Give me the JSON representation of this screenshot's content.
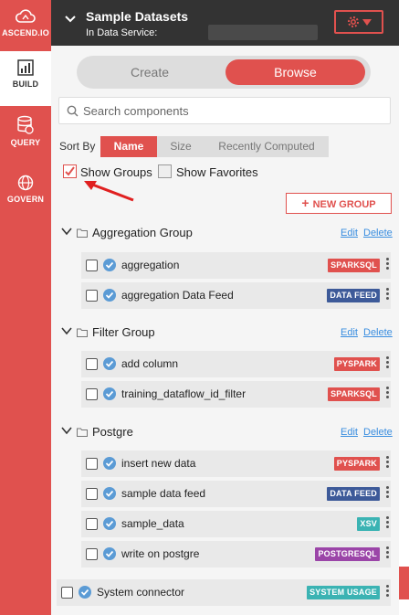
{
  "nav": {
    "logo_label": "ASCEND.IO",
    "items": [
      {
        "label": "BUILD"
      },
      {
        "label": "QUERY"
      },
      {
        "label": "GOVERN"
      }
    ]
  },
  "header": {
    "title": "Sample Datasets",
    "subtitle": "In Data Service:"
  },
  "mode_toggle": {
    "create_label": "Create",
    "browse_label": "Browse",
    "active": "Browse"
  },
  "search": {
    "placeholder": "Search components",
    "value": ""
  },
  "sort": {
    "label": "Sort By",
    "options": [
      "Name",
      "Size",
      "Recently Computed"
    ],
    "selected": "Name"
  },
  "filters": {
    "show_groups_label": "Show Groups",
    "show_groups_checked": true,
    "show_favorites_label": "Show Favorites",
    "show_favorites_checked": false
  },
  "new_group_label": "NEW GROUP",
  "group_actions": {
    "edit": "Edit",
    "delete": "Delete"
  },
  "groups": [
    {
      "name": "Aggregation Group",
      "items": [
        {
          "name": "aggregation",
          "type": "SPARKSQL"
        },
        {
          "name": "aggregation Data Feed",
          "type": "DATA FEED"
        }
      ]
    },
    {
      "name": "Filter Group",
      "items": [
        {
          "name": "add column",
          "type": "PYSPARK"
        },
        {
          "name": "training_dataflow_id_filter",
          "type": "SPARKSQL"
        }
      ]
    },
    {
      "name": "Postgre",
      "items": [
        {
          "name": "insert new data",
          "type": "PYSPARK"
        },
        {
          "name": "sample data feed",
          "type": "DATA FEED"
        },
        {
          "name": "sample_data",
          "type": "XSV"
        },
        {
          "name": "write on postgre",
          "type": "POSTGRESQL"
        }
      ]
    }
  ],
  "ungrouped": [
    {
      "name": "System connector",
      "type": "SYSTEM USAGE"
    }
  ],
  "badge_colors": {
    "SPARKSQL": "#e0514e",
    "PYSPARK": "#e0514e",
    "DATA FEED": "#3d5a99",
    "XSV": "#3bb3b3",
    "POSTGRESQL": "#9b45a8",
    "SYSTEM USAGE": "#3bb3b3"
  },
  "colors": {
    "accent": "#e0514e",
    "header_bg": "#333333",
    "link": "#3a8ee0"
  }
}
